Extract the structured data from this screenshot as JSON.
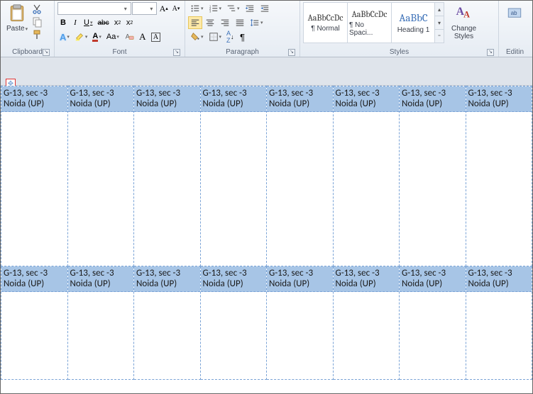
{
  "ribbon": {
    "clipboard": {
      "label": "Clipboard",
      "paste": "Paste"
    },
    "font": {
      "label": "Font",
      "fontname": "",
      "fontsize": "",
      "bold": "B",
      "italic": "I",
      "underline": "U",
      "strike": "abc",
      "sub": "x",
      "sup": "x"
    },
    "paragraph": {
      "label": "Paragraph"
    },
    "styles": {
      "label": "Styles",
      "items": [
        {
          "preview": "AaBbCcDc",
          "name": "¶ Normal"
        },
        {
          "preview": "AaBbCcDc",
          "name": "¶ No Spaci..."
        },
        {
          "preview": "AaBbC",
          "name": "Heading 1"
        }
      ],
      "change": "Change\nStyles"
    },
    "editing": {
      "label": "Editin"
    }
  },
  "table": {
    "cell": {
      "line1": "G-13, sec -3",
      "line2": "Noida (UP)"
    }
  }
}
